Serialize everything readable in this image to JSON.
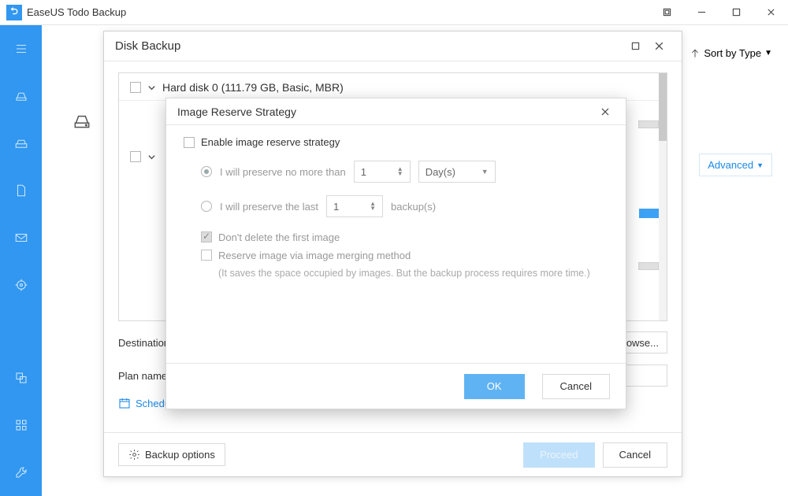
{
  "app": {
    "title": "EaseUS Todo Backup"
  },
  "sort": {
    "label": "Sort by Type"
  },
  "advanced": {
    "label": "Advanced"
  },
  "dlg1": {
    "title": "Disk Backup",
    "disk0": "Hard disk 0 (111.79 GB, Basic, MBR)",
    "dest_label": "Destination",
    "plan_label": "Plan name",
    "browse": "Browse...",
    "schedule": "Schedu",
    "backup_options": "Backup options",
    "proceed": "Proceed",
    "cancel": "Cancel"
  },
  "dlg2": {
    "title": "Image Reserve Strategy",
    "enable": "Enable image reserve strategy",
    "opt1_pre": "I will preserve no more than",
    "opt1_num": "1",
    "opt1_unit": "Day(s)",
    "opt2_pre": "I will preserve the last",
    "opt2_num": "1",
    "opt2_post": "backup(s)",
    "chk1": "Don't delete the first image",
    "chk2": "Reserve image via image merging method",
    "chk2_note": "(It saves the space occupied by images. But the backup process requires more time.)",
    "ok": "OK",
    "cancel": "Cancel"
  }
}
